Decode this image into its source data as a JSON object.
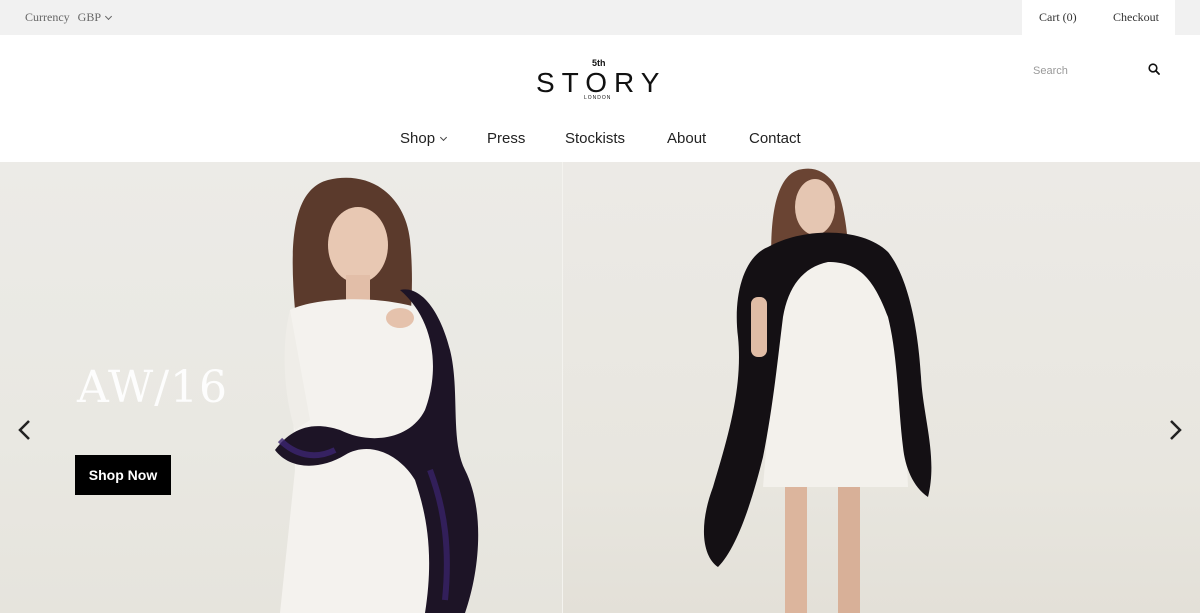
{
  "topbar": {
    "currency_label": "Currency",
    "currency_value": "GBP",
    "cart_label": "Cart (0)",
    "checkout_label": "Checkout"
  },
  "logo": {
    "fifth": "5th",
    "word": "STORY",
    "sub": "LONDON"
  },
  "search": {
    "placeholder": "Search"
  },
  "nav": {
    "items": [
      {
        "label": "Shop"
      },
      {
        "label": "Press"
      },
      {
        "label": "Stockists"
      },
      {
        "label": "About"
      },
      {
        "label": "Contact"
      }
    ]
  },
  "hero": {
    "title": "AW/16",
    "cta_label": "Shop Now"
  },
  "icons": {
    "search": "search-icon",
    "prev": "chevron-left-icon",
    "next": "chevron-right-icon",
    "dropdown": "chevron-down-icon"
  },
  "colors": {
    "topbar_bg": "#f1f1f1",
    "cta_bg": "#000000",
    "hero_bg": "#e9e8e2"
  }
}
